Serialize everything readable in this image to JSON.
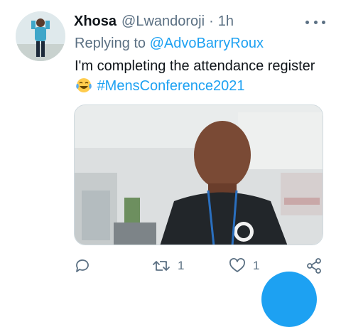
{
  "tweet": {
    "display_name": "Xhosa",
    "handle": "@Lwandoroji",
    "separator": "·",
    "time": "1h",
    "replying_prefix": "Replying to",
    "replying_to": "@AdvoBarryRoux",
    "text_before_emoji": "I'm completing the attendance register",
    "emoji": "face-with-tears-of-joy",
    "hashtag": "#MensConference2021",
    "media_icon": "photo"
  },
  "actions": {
    "reply_icon": "reply-icon",
    "retweet_icon": "retweet-icon",
    "retweet_count": "1",
    "like_icon": "heart-icon",
    "like_count": "1",
    "share_icon": "share-icon"
  },
  "colors": {
    "accent": "#1da1f2",
    "secondary_text": "#5b7083",
    "primary_text": "#0f1419"
  }
}
